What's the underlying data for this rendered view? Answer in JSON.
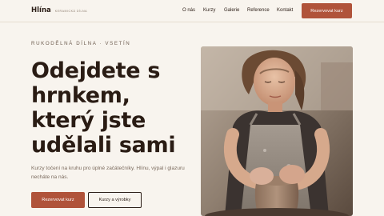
{
  "nav": {
    "brand_name": "Hlína",
    "brand_sub": "KERAMICKÁ DÍLNA",
    "links": [
      "O nás",
      "Kurzy",
      "Galerie",
      "Reference",
      "Kontakt"
    ],
    "cta": "Rezervovat kurz"
  },
  "hero": {
    "eyebrow": "RUKODĚLNÁ DÍLNA · VSETÍN",
    "headline": "Odejdete s hrnkem, který jste udělali sami",
    "lead": "Kurzy točení na kruhu pro úplné začátečníky. Hlínu, výpal i glazuru necháte na nás.",
    "primary_button": "Rezervovat kurz",
    "secondary_button": "Kurzy a výrobky"
  },
  "colors": {
    "background": "#f8f4ee",
    "accent": "#b0533a",
    "text": "#2b1d16"
  }
}
